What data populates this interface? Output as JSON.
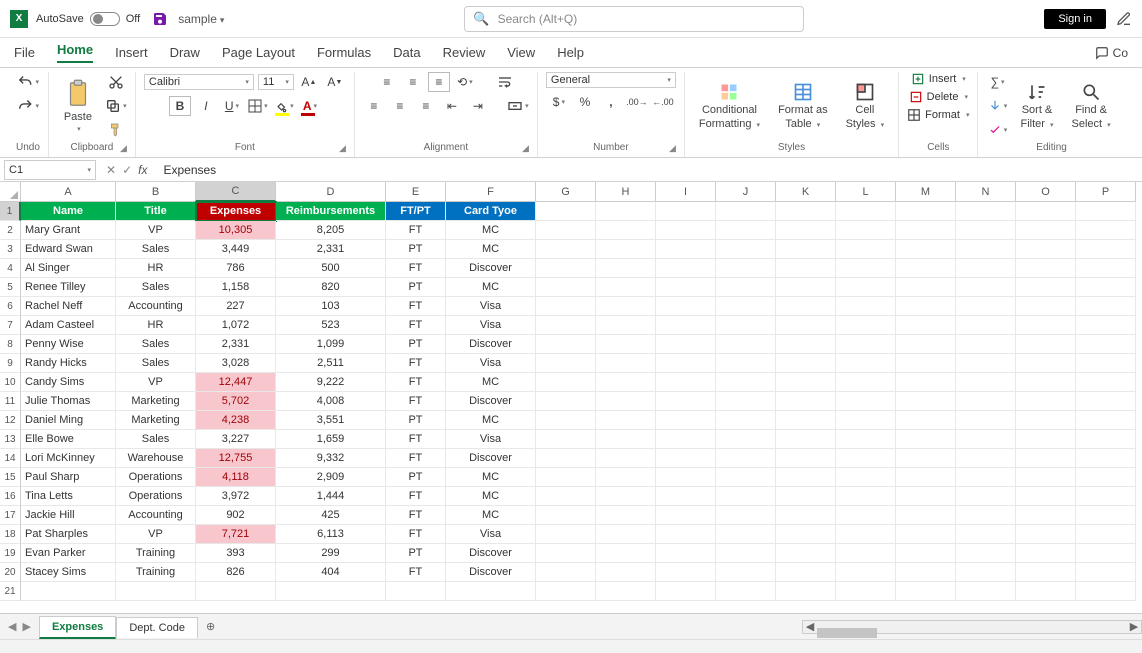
{
  "titlebar": {
    "app_letter": "X",
    "autosave_label": "AutoSave",
    "autosave_state": "Off",
    "filename": "sample",
    "search_placeholder": "Search (Alt+Q)",
    "signin": "Sign in"
  },
  "tabs": {
    "file": "File",
    "home": "Home",
    "insert": "Insert",
    "draw": "Draw",
    "page_layout": "Page Layout",
    "formulas": "Formulas",
    "data": "Data",
    "review": "Review",
    "view": "View",
    "help": "Help",
    "comments": "Co"
  },
  "ribbon": {
    "undo": "Undo",
    "clipboard": "Clipboard",
    "paste": "Paste",
    "font_group": "Font",
    "font_name": "Calibri",
    "font_size": "11",
    "alignment": "Alignment",
    "number_group": "Number",
    "number_format": "General",
    "styles_group": "Styles",
    "cond_fmt": "Conditional",
    "cond_fmt2": "Formatting",
    "fmt_table": "Format as",
    "fmt_table2": "Table",
    "cell_styles": "Cell",
    "cell_styles2": "Styles",
    "cells_group": "Cells",
    "insert": "Insert",
    "delete": "Delete",
    "format": "Format",
    "editing_group": "Editing",
    "sort": "Sort &",
    "sort2": "Filter",
    "find": "Find &",
    "find2": "Select"
  },
  "formula": {
    "namebox": "C1",
    "content": "Expenses"
  },
  "columns": [
    "A",
    "B",
    "C",
    "D",
    "E",
    "F",
    "G",
    "H",
    "I",
    "J",
    "K",
    "L",
    "M",
    "N",
    "O",
    "P"
  ],
  "col_widths": [
    "cA",
    "cB",
    "cC",
    "cD",
    "cE",
    "cF",
    "cR",
    "cR",
    "cR",
    "cR",
    "cR",
    "cR",
    "cR",
    "cR",
    "cR",
    "cR"
  ],
  "active_col_index": 2,
  "active_row_index": 0,
  "header_row": {
    "cells": [
      {
        "text": "Name",
        "cls": "hdr-green"
      },
      {
        "text": "Title",
        "cls": "hdr-green"
      },
      {
        "text": "Expenses",
        "cls": "hdr-red active-cell"
      },
      {
        "text": "Reimbursements",
        "cls": "hdr-green"
      },
      {
        "text": "FT/PT",
        "cls": "hdr-blue"
      },
      {
        "text": "Card Tyoe",
        "cls": "hdr-blue"
      }
    ]
  },
  "rows": [
    {
      "name": "Mary Grant",
      "title": "VP",
      "exp": "10,305",
      "exp_hl": true,
      "reimb": "8,205",
      "ftpt": "FT",
      "card": "MC"
    },
    {
      "name": "Edward Swan",
      "title": "Sales",
      "exp": "3,449",
      "exp_hl": false,
      "reimb": "2,331",
      "ftpt": "PT",
      "card": "MC"
    },
    {
      "name": "Al Singer",
      "title": "HR",
      "exp": "786",
      "exp_hl": false,
      "reimb": "500",
      "ftpt": "FT",
      "card": "Discover"
    },
    {
      "name": "Renee Tilley",
      "title": "Sales",
      "exp": "1,158",
      "exp_hl": false,
      "reimb": "820",
      "ftpt": "PT",
      "card": "MC"
    },
    {
      "name": "Rachel Neff",
      "title": "Accounting",
      "exp": "227",
      "exp_hl": false,
      "reimb": "103",
      "ftpt": "FT",
      "card": "Visa"
    },
    {
      "name": "Adam Casteel",
      "title": "HR",
      "exp": "1,072",
      "exp_hl": false,
      "reimb": "523",
      "ftpt": "FT",
      "card": "Visa"
    },
    {
      "name": "Penny Wise",
      "title": "Sales",
      "exp": "2,331",
      "exp_hl": false,
      "reimb": "1,099",
      "ftpt": "PT",
      "card": "Discover"
    },
    {
      "name": "Randy Hicks",
      "title": "Sales",
      "exp": "3,028",
      "exp_hl": false,
      "reimb": "2,511",
      "ftpt": "FT",
      "card": "Visa"
    },
    {
      "name": "Candy Sims",
      "title": "VP",
      "exp": "12,447",
      "exp_hl": true,
      "reimb": "9,222",
      "ftpt": "FT",
      "card": "MC"
    },
    {
      "name": "Julie Thomas",
      "title": "Marketing",
      "exp": "5,702",
      "exp_hl": true,
      "reimb": "4,008",
      "ftpt": "FT",
      "card": "Discover"
    },
    {
      "name": "Daniel Ming",
      "title": "Marketing",
      "exp": "4,238",
      "exp_hl": true,
      "reimb": "3,551",
      "ftpt": "PT",
      "card": "MC"
    },
    {
      "name": "Elle Bowe",
      "title": "Sales",
      "exp": "3,227",
      "exp_hl": false,
      "reimb": "1,659",
      "ftpt": "FT",
      "card": "Visa"
    },
    {
      "name": "Lori McKinney",
      "title": "Warehouse",
      "exp": "12,755",
      "exp_hl": true,
      "reimb": "9,332",
      "ftpt": "FT",
      "card": "Discover"
    },
    {
      "name": "Paul Sharp",
      "title": "Operations",
      "exp": "4,118",
      "exp_hl": true,
      "reimb": "2,909",
      "ftpt": "PT",
      "card": "MC"
    },
    {
      "name": "Tina Letts",
      "title": "Operations",
      "exp": "3,972",
      "exp_hl": false,
      "reimb": "1,444",
      "ftpt": "FT",
      "card": "MC"
    },
    {
      "name": "Jackie Hill",
      "title": "Accounting",
      "exp": "902",
      "exp_hl": false,
      "reimb": "425",
      "ftpt": "FT",
      "card": "MC"
    },
    {
      "name": "Pat Sharples",
      "title": "VP",
      "exp": "7,721",
      "exp_hl": true,
      "reimb": "6,113",
      "ftpt": "FT",
      "card": "Visa"
    },
    {
      "name": "Evan Parker",
      "title": "Training",
      "exp": "393",
      "exp_hl": false,
      "reimb": "299",
      "ftpt": "PT",
      "card": "Discover"
    },
    {
      "name": "Stacey Sims",
      "title": "Training",
      "exp": "826",
      "exp_hl": false,
      "reimb": "404",
      "ftpt": "FT",
      "card": "Discover"
    }
  ],
  "blank_rows": [
    21
  ],
  "sheets": {
    "active": "Expenses",
    "other": "Dept. Code"
  }
}
